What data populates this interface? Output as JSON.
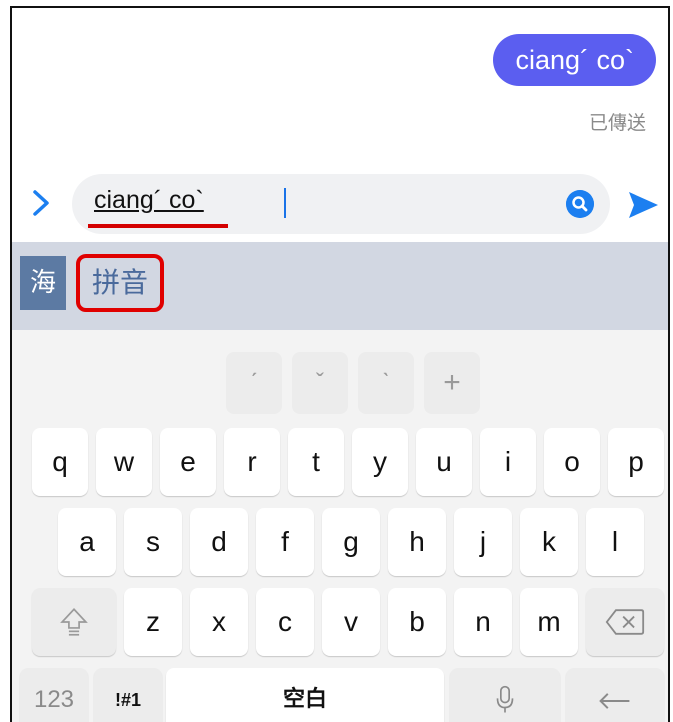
{
  "chat": {
    "message": "ciang´ co`",
    "status": "已傳送"
  },
  "composer": {
    "text": "ciang´ co`",
    "expand_icon": "chevron-right-icon",
    "search_icon": "search-icon",
    "send_icon": "send-icon"
  },
  "ime": {
    "logo": "海",
    "mode_label": "拼音",
    "tone_keys": [
      "ˊ",
      "ˇ",
      "ˋ",
      "+"
    ],
    "row1": [
      "q",
      "w",
      "e",
      "r",
      "t",
      "y",
      "u",
      "i",
      "o",
      "p"
    ],
    "row2": [
      "a",
      "s",
      "d",
      "f",
      "g",
      "h",
      "j",
      "k",
      "l"
    ],
    "row3": [
      "z",
      "x",
      "c",
      "v",
      "b",
      "n",
      "m"
    ],
    "bottom": {
      "num_label": "123",
      "sym_label": "!#1",
      "space_label": "空白"
    }
  },
  "colors": {
    "bubble": "#5b5ef0",
    "accent_blue": "#1c7ff0",
    "highlight_red": "#e00000",
    "candidate_bar": "#d2d7e2"
  }
}
